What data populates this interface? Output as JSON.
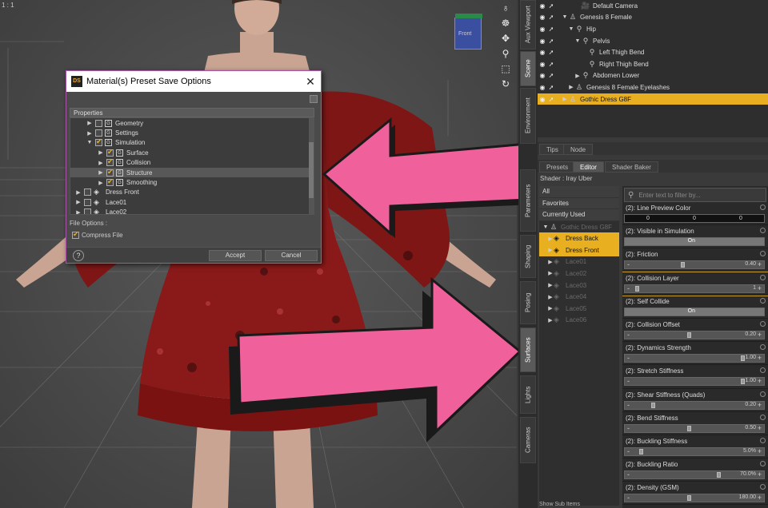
{
  "viewport": {
    "label": "1 : 1",
    "nav_cube_text": "Front"
  },
  "dialog": {
    "title": "Material(s) Preset Save Options",
    "logo": "DS",
    "properties_header": "Properties",
    "tree": [
      {
        "label": "Geometry",
        "indent": 1,
        "checked": false,
        "icon": "g",
        "expand": "right"
      },
      {
        "label": "Settings",
        "indent": 1,
        "checked": false,
        "icon": "g",
        "expand": "right"
      },
      {
        "label": "Simulation",
        "indent": 1,
        "checked": true,
        "icon": "g",
        "expand": "down"
      },
      {
        "label": "Surface",
        "indent": 2,
        "checked": true,
        "icon": "g",
        "expand": "right"
      },
      {
        "label": "Collision",
        "indent": 2,
        "checked": true,
        "icon": "g",
        "expand": "right"
      },
      {
        "label": "Structure",
        "indent": 2,
        "checked": true,
        "icon": "g",
        "expand": "right",
        "selected": true
      },
      {
        "label": "Smoothing",
        "indent": 2,
        "checked": true,
        "icon": "g",
        "expand": "right"
      },
      {
        "label": "Dress Front",
        "indent": 0,
        "checked": false,
        "icon": "diamond",
        "expand": "right"
      },
      {
        "label": "Lace01",
        "indent": 0,
        "checked": false,
        "icon": "diamond",
        "expand": "right"
      },
      {
        "label": "Lace02",
        "indent": 0,
        "checked": false,
        "icon": "diamond",
        "expand": "right"
      }
    ],
    "file_options_label": "File Options :",
    "compress_label": "Compress File",
    "compress_checked": true,
    "help": "?",
    "accept": "Accept",
    "cancel": "Cancel"
  },
  "side_tabs": {
    "top": [
      "Aux Viewport",
      "Scene",
      "Environment"
    ],
    "bottom": [
      "Parameters",
      "Shaping",
      "Posing",
      "Surfaces",
      "Lights",
      "Cameras"
    ]
  },
  "scene": {
    "rows": [
      {
        "label": "Default Camera",
        "indent": 3,
        "icon": "camera-icon",
        "selected": false
      },
      {
        "label": "Genesis 8 Female",
        "indent": 1,
        "icon": "figure-icon",
        "selected": false
      },
      {
        "label": "Hip",
        "indent": 2,
        "icon": "bone-icon",
        "selected": false
      },
      {
        "label": "Pelvis",
        "indent": 3,
        "icon": "bone-icon",
        "selected": false
      },
      {
        "label": "Left Thigh Bend",
        "indent": 4,
        "icon": "bone-icon",
        "selected": false
      },
      {
        "label": "Right Thigh Bend",
        "indent": 4,
        "icon": "bone-icon",
        "selected": false
      },
      {
        "label": "Abdomen Lower",
        "indent": 3,
        "icon": "bone-icon",
        "selected": false
      },
      {
        "label": "Genesis 8 Female Eyelashes",
        "indent": 2,
        "icon": "figure-icon",
        "selected": false
      },
      {
        "label": "Gothic Dress G8F",
        "indent": 1,
        "icon": "figure-icon",
        "selected": true
      }
    ]
  },
  "tabs": {
    "tips": "Tips",
    "node": "Node",
    "presets": "Presets",
    "editor": "Editor",
    "shader_baker": "Shader Baker"
  },
  "shader_label": "Shader : Iray Uber",
  "surfaces": {
    "filters": [
      "All",
      "Favorites",
      "Currently Used"
    ],
    "object": "Gothic Dress G8F",
    "materials": [
      {
        "label": "Dress Back",
        "selected": true
      },
      {
        "label": "Dress Front",
        "selected": true
      },
      {
        "label": "Lace01",
        "selected": false
      },
      {
        "label": "Lace02",
        "selected": false
      },
      {
        "label": "Lace03",
        "selected": false
      },
      {
        "label": "Lace04",
        "selected": false
      },
      {
        "label": "Lace05",
        "selected": false
      },
      {
        "label": "Lace06",
        "selected": false
      }
    ]
  },
  "filter_placeholder": "Enter text to filter by...",
  "properties": [
    {
      "name": "(2): Line Preview Color",
      "type": "color",
      "values": [
        "0",
        "0",
        "0"
      ]
    },
    {
      "name": "(2): Visible in Simulation",
      "type": "toggle",
      "value": "On"
    },
    {
      "name": "(2): Friction",
      "type": "slider",
      "value": "0.40",
      "level": 0.4
    },
    {
      "name": "(2): Collision Layer",
      "type": "slider",
      "value": "1",
      "level": 0.02,
      "highlight": true
    },
    {
      "name": "(2): Self Collide",
      "type": "toggle",
      "value": "On"
    },
    {
      "name": "(2): Collision Offset",
      "type": "slider",
      "value": "0.20",
      "level": 0.45
    },
    {
      "name": "(2): Dynamics Strength",
      "type": "slider",
      "value": "1.00",
      "level": 0.9
    },
    {
      "name": "(2): Stretch Stiffness",
      "type": "slider",
      "value": "1.00",
      "level": 0.9
    },
    {
      "name": "(2): Shear Stiffness (Quads)",
      "type": "slider",
      "value": "0.20",
      "level": 0.15
    },
    {
      "name": "(2): Bend Stiffness",
      "type": "slider",
      "value": "0.50",
      "level": 0.45
    },
    {
      "name": "(2): Buckling Stiffness",
      "type": "slider",
      "value": "5.0%",
      "level": 0.05
    },
    {
      "name": "(2): Buckling Ratio",
      "type": "slider",
      "value": "70.0%",
      "level": 0.7
    },
    {
      "name": "(2): Density (GSM)",
      "type": "slider",
      "value": "180.00",
      "level": 0.45
    }
  ],
  "show_sub_items": "Show Sub Items",
  "colors": {
    "highlight": "#e8b020",
    "arrow": "#f0609a",
    "dress": "#8a1a1a"
  }
}
